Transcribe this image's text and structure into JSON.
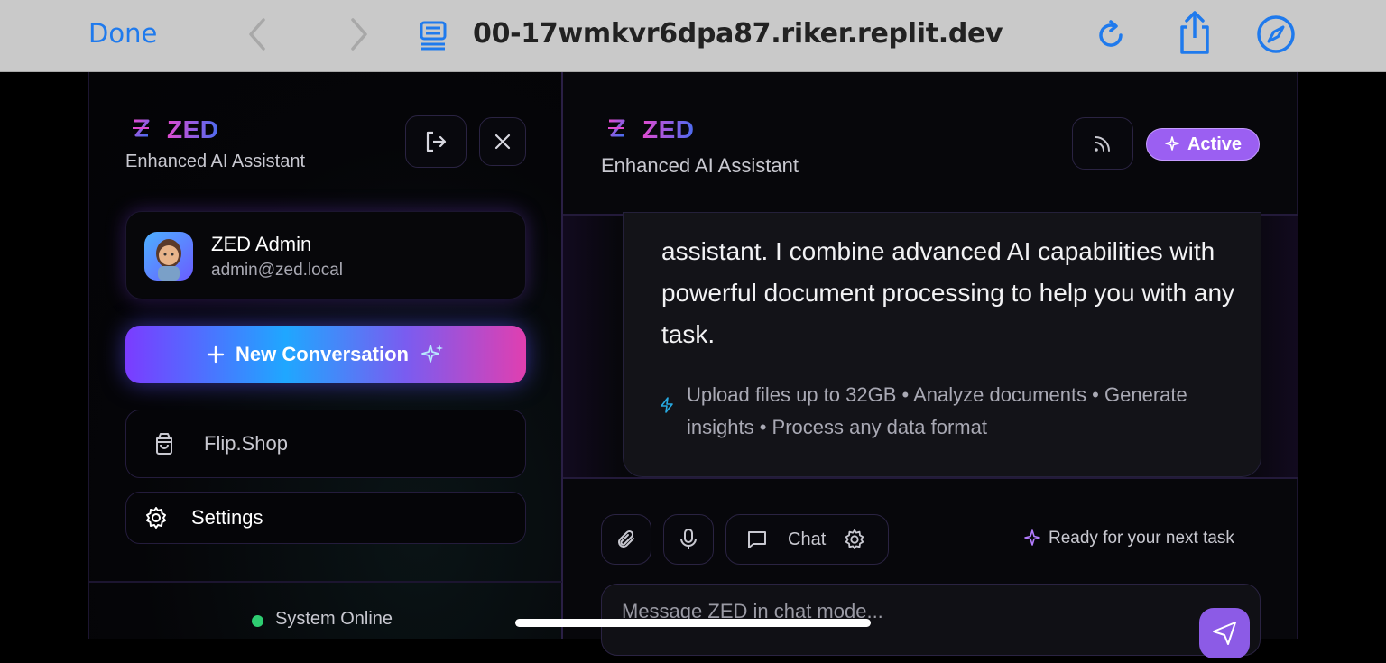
{
  "browser": {
    "done_label": "Done",
    "url": "00-17wmkvr6dpa87.riker.replit.dev",
    "icons": [
      "back-icon",
      "forward-icon",
      "reader-icon",
      "reload-icon",
      "share-icon",
      "compass-icon"
    ]
  },
  "sidebar": {
    "logo_text": "ZED",
    "subtitle": "Enhanced AI Assistant",
    "user": {
      "name": "ZED Admin",
      "email": "admin@zed.local"
    },
    "new_conversation_label": "New Conversation",
    "menu": [
      {
        "label": "Flip.Shop",
        "icon": "shopping-bag-icon"
      },
      {
        "label": "Settings",
        "icon": "gear-icon"
      }
    ],
    "status_text": "System Online"
  },
  "chat": {
    "logo_text": "ZED",
    "subtitle": "Enhanced AI Assistant",
    "active_label": "Active",
    "message_text": "assistant. I combine advanced AI capabilities with powerful document processing to help you with any task.",
    "hint_text": "Upload files up to 32GB • Analyze documents • Generate insights • Process any data format",
    "mode_label": "Chat",
    "ready_text": "Ready for your next task",
    "input_placeholder": "Message ZED in chat mode..."
  },
  "colors": {
    "accent": "#9b5ff2",
    "browser_blue": "#1f7aed",
    "status_green": "#2ecc71"
  }
}
